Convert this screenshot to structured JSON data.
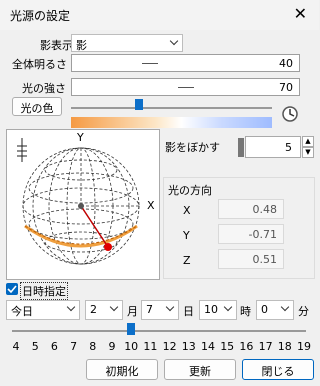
{
  "window": {
    "title": "光源の設定"
  },
  "shadow": {
    "label": "影表示",
    "value": "影"
  },
  "brightness": {
    "label": "全体明るさ",
    "value": "40"
  },
  "intensity": {
    "label": "光の強さ",
    "value": "70"
  },
  "light_color": {
    "button_label": "光の色"
  },
  "blur": {
    "label": "影をぼかす",
    "value": "5"
  },
  "direction": {
    "title": "光の方向",
    "x_label": "X",
    "x_value": "0.48",
    "y_label": "Y",
    "y_value": "-0.71",
    "z_label": "Z",
    "z_value": "0.51"
  },
  "sphere": {
    "x_axis": "X",
    "y_axis": "Y"
  },
  "datetime": {
    "checkbox_label": "日時指定",
    "checked": true,
    "day_preset": "今日",
    "month_value": "2",
    "month_unit": "月",
    "day_value": "7",
    "day_unit": "日",
    "hour_value": "10",
    "hour_unit": "時",
    "minute_value": "0",
    "minute_unit": "分",
    "hour_slider_value": 10,
    "ticks": [
      "4",
      "5",
      "6",
      "7",
      "8",
      "9",
      "10",
      "11",
      "12",
      "13",
      "14",
      "15",
      "16",
      "17",
      "18",
      "19"
    ]
  },
  "buttons": {
    "reset": "初期化",
    "update": "更新",
    "close": "閉じる"
  }
}
